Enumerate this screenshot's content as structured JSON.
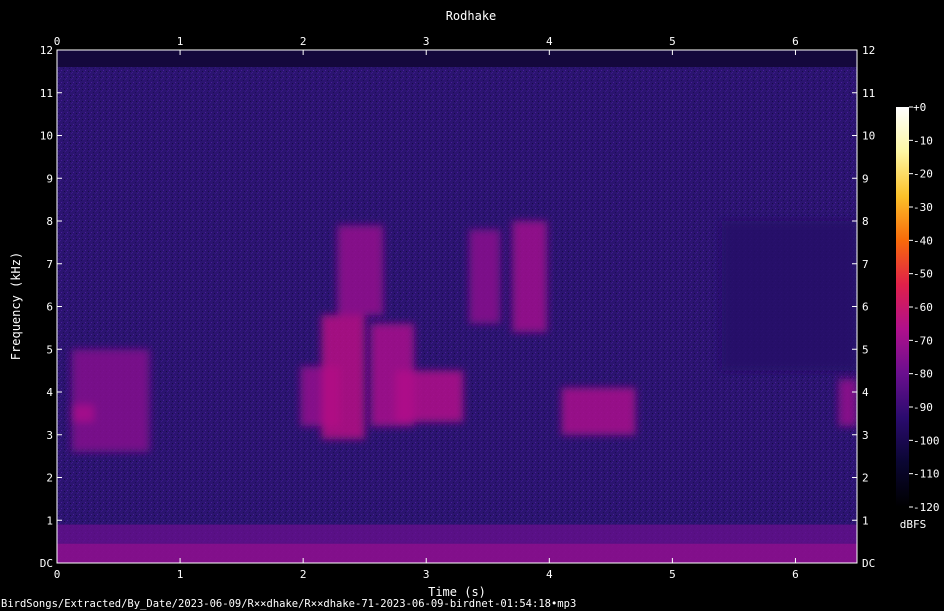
{
  "chart_data": {
    "type": "heatmap",
    "title": "Rodhake",
    "xlabel": "Time (s)",
    "ylabel": "Frequency (kHz)",
    "x_ticks": [
      "0",
      "1",
      "2",
      "3",
      "4",
      "5",
      "6"
    ],
    "y_ticks": [
      "DC",
      "1",
      "2",
      "3",
      "4",
      "5",
      "6",
      "7",
      "8",
      "9",
      "10",
      "11",
      "12"
    ],
    "xlim": [
      0,
      6.5
    ],
    "ylim": [
      0,
      12
    ],
    "colorbar": {
      "ticks": [
        "+0",
        "-10",
        "-20",
        "-30",
        "-40",
        "-50",
        "-60",
        "-70",
        "-80",
        "-90",
        "-100",
        "-110",
        "-120"
      ],
      "range": [
        -120,
        0
      ],
      "unit": "dBFS",
      "colors": [
        "#000000",
        "#0a0632",
        "#2a0b6e",
        "#6a0f8e",
        "#b0108c",
        "#e0204a",
        "#f86a0a",
        "#fbc12a",
        "#fdf7a4",
        "#ffffff"
      ]
    },
    "background_level_dbfs": -105,
    "signal_regions": [
      {
        "t0": 0.12,
        "t1": 0.75,
        "f0": 2.6,
        "f1": 5.0,
        "level": -75
      },
      {
        "t0": 0.12,
        "t1": 0.3,
        "f0": 3.3,
        "f1": 3.7,
        "level": -68
      },
      {
        "t0": 1.98,
        "t1": 2.3,
        "f0": 3.2,
        "f1": 4.6,
        "level": -72
      },
      {
        "t0": 2.15,
        "t1": 2.5,
        "f0": 2.9,
        "f1": 5.8,
        "level": -65
      },
      {
        "t0": 2.28,
        "t1": 2.65,
        "f0": 5.8,
        "f1": 7.9,
        "level": -72
      },
      {
        "t0": 2.55,
        "t1": 2.9,
        "f0": 3.2,
        "f1": 5.6,
        "level": -68
      },
      {
        "t0": 2.75,
        "t1": 3.3,
        "f0": 3.3,
        "f1": 4.5,
        "level": -66
      },
      {
        "t0": 3.35,
        "t1": 3.6,
        "f0": 5.6,
        "f1": 7.8,
        "level": -74
      },
      {
        "t0": 3.7,
        "t1": 3.98,
        "f0": 5.4,
        "f1": 8.0,
        "level": -70
      },
      {
        "t0": 4.1,
        "t1": 4.7,
        "f0": 3.0,
        "f1": 4.1,
        "level": -68
      },
      {
        "t0": 5.4,
        "t1": 6.5,
        "f0": 4.5,
        "f1": 8.0,
        "level": -95
      },
      {
        "t0": 6.35,
        "t1": 6.5,
        "f0": 3.2,
        "f1": 4.3,
        "level": -72
      }
    ],
    "low_band": {
      "f0": 0.0,
      "f1": 0.9,
      "level": -80
    }
  },
  "footer": {
    "filename": "BirdSongs/Extracted/By_Date/2023-06-09/R××dhake/R××dhake-71-2023-06-09-birdnet-01:54:18•mp3"
  }
}
